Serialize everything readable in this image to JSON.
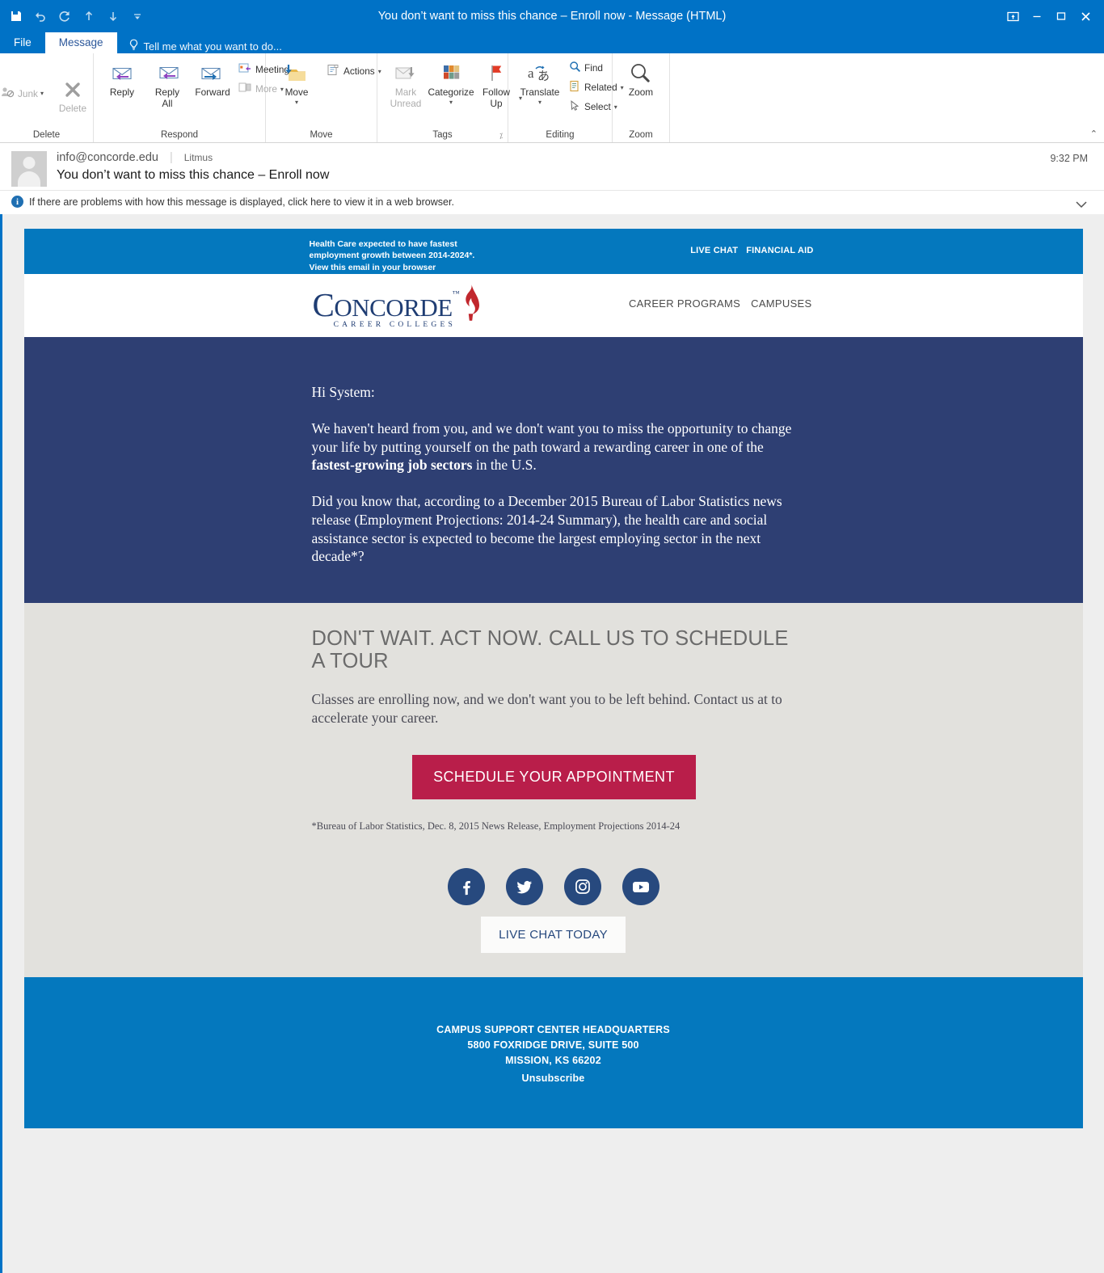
{
  "window": {
    "title": "You don’t want to miss this chance – Enroll now - Message (HTML)",
    "qat": {
      "save": "save-icon",
      "undo": "undo-icon",
      "redo": "redo-icon",
      "up": "previous-item-icon",
      "down": "next-item-icon",
      "more": "customize-quick-access-toolbar-icon"
    },
    "controls": {
      "restore_ribbon": "touch-mode-icon",
      "minimize": "minimize-icon",
      "maximize": "maximize-icon",
      "close": "close-icon"
    }
  },
  "ribbon": {
    "tabs": [
      {
        "label": "File",
        "active": false
      },
      {
        "label": "Message",
        "active": true
      }
    ],
    "tell_me": "Tell me what you want to do...",
    "collapse_caret": "⌃",
    "groups": [
      {
        "label": "Delete",
        "buttons": [
          {
            "label": "Junk",
            "disabled": true,
            "dropdown": true
          },
          {
            "label": "Delete",
            "disabled": true,
            "dropdown": false
          }
        ]
      },
      {
        "label": "Respond",
        "buttons": [
          {
            "label": "Reply",
            "disabled": false
          },
          {
            "label": "Reply\nAll",
            "disabled": false
          },
          {
            "label": "Forward",
            "disabled": false
          },
          {
            "label": "Meeting",
            "disabled": false
          },
          {
            "label": "More",
            "disabled": true,
            "dropdown": true
          }
        ]
      },
      {
        "label": "Move",
        "buttons": [
          {
            "label": "Move",
            "disabled": false,
            "dropdown": true
          },
          {
            "label": "Actions",
            "disabled": false,
            "dropdown": true
          }
        ]
      },
      {
        "label": "Tags",
        "dialog_launcher": true,
        "buttons": [
          {
            "label": "Mark\nUnread",
            "disabled": true
          },
          {
            "label": "Categorize",
            "disabled": false,
            "dropdown": true
          },
          {
            "label": "Follow\nUp",
            "disabled": false,
            "dropdown": true
          }
        ]
      },
      {
        "label": "Editing",
        "buttons": [
          {
            "label": "Translate",
            "disabled": false,
            "dropdown": true
          },
          {
            "label": "Find",
            "disabled": false
          },
          {
            "label": "Related",
            "disabled": false,
            "dropdown": true
          },
          {
            "label": "Select",
            "disabled": false,
            "dropdown": true
          }
        ]
      },
      {
        "label": "Zoom",
        "buttons": [
          {
            "label": "Zoom",
            "disabled": false
          }
        ]
      }
    ]
  },
  "message": {
    "from": "info@concorde.edu",
    "from_tag": "Litmus",
    "subject": "You don’t want to miss this chance – Enroll now",
    "time": "9:32 PM",
    "infobar": "If there are problems with how this message is displayed, click here to view it in a web browser."
  },
  "email": {
    "banner": {
      "preheader": "Health Care expected to have fastest employment growth between 2014-2024*.  View this email in your browser",
      "links": [
        "LIVE CHAT",
        "FINANCIAL AID"
      ]
    },
    "brand": {
      "name_c": "C",
      "name_rest": "ONCORDE",
      "tm": "™",
      "tagline": "CAREER COLLEGES"
    },
    "nav": [
      "CAREER PROGRAMS",
      "CAMPUSES"
    ],
    "body": {
      "greeting": "Hi System:",
      "p1_a": "We haven't heard from you, and we don't want you to miss the opportunity to change your life by putting yourself on the path toward a rewarding career in one of the ",
      "p1_b": "fastest-growing job sectors",
      "p1_c": " in the U.S.",
      "p2": "Did you know that, according to a December 2015 Bureau of Labor Statistics news release (Employment Projections: 2014-24 Summary), the health care and social assistance sector is expected to become the largest employing sector in the next decade*?"
    },
    "cta": {
      "heading": "DON'T WAIT. ACT NOW. CALL US TO SCHEDULE A TOUR",
      "paragraph": "Classes are enrolling now, and we don't want you to be left behind. Contact us at  to accelerate your career.",
      "button": "SCHEDULE YOUR APPOINTMENT",
      "footnote": "*Bureau of Labor Statistics, Dec. 8, 2015 News Release, Employment Projections 2014-24"
    },
    "social": {
      "icons": [
        "facebook-icon",
        "twitter-icon",
        "instagram-icon",
        "youtube-icon"
      ],
      "live_chat_button": "LIVE CHAT TODAY"
    },
    "footer": {
      "line1": "CAMPUS SUPPORT CENTER HEADQUARTERS",
      "line2": "5800 FOXRIDGE DRIVE, SUITE 500",
      "line3": "MISSION, KS 66202",
      "unsubscribe": "Unsubscribe"
    }
  },
  "colors": {
    "outlook_blue": "#0072C6",
    "brand_banner_blue": "#0478BE",
    "brand_navy": "#2E3F73",
    "brand_red": "#B91E4A",
    "social_navy": "#27497E",
    "cta_gray": "#E2E1DD"
  }
}
